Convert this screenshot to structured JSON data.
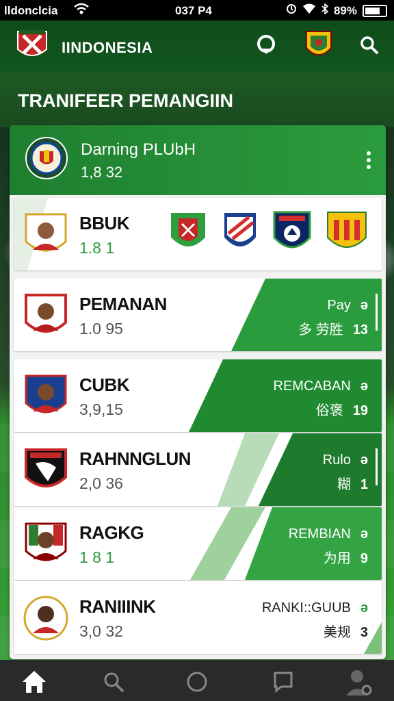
{
  "status_bar": {
    "carrier": "lldonclcia",
    "time": "037 P4",
    "battery": "89%"
  },
  "header": {
    "title": "IINDONESIA",
    "icons": [
      "club-logo-icon",
      "notification-icon",
      "club-crest-icon",
      "search-icon"
    ]
  },
  "section_title": "TRANIFEER PEMANGIIN",
  "club": {
    "name": "Darning PLUbH",
    "value": "1,8 32"
  },
  "rows": [
    {
      "name": "BBUK",
      "value": "1.8 1",
      "value_color": "#2b9c3d",
      "type": "clubs"
    },
    {
      "name": "PEMANAN",
      "value": "1.0 95",
      "meta_top": "Pay",
      "meta_bottom": "多 劳胜",
      "count": "13"
    },
    {
      "name": "CUBK",
      "value": "3,9,15",
      "meta_top": "REMCABAN",
      "meta_bottom": "俗褒",
      "count": "19"
    },
    {
      "name": "RAHNNGLUN",
      "value": "2,0 36",
      "meta_top": "Rulo",
      "meta_bottom": "糊",
      "count": "1"
    },
    {
      "name": "RAGKG",
      "value": "1 8 1",
      "meta_top": "REMBIAN",
      "meta_bottom": "为用",
      "count": "9"
    },
    {
      "name": "RANIIINK",
      "value": "3,0 32",
      "meta_top": "RANKI::GUUB",
      "meta_bottom": "美规",
      "count": "3"
    }
  ],
  "row_icon_glyph": "ə",
  "colors": {
    "primary_green": "#2b9c3d",
    "dark_green": "#1f7f30",
    "header_green": "#0f4d1a",
    "nav_bg": "#2a2a2a"
  },
  "bottom_nav": [
    "home-icon",
    "search-icon",
    "circle-icon",
    "chat-icon",
    "profile-settings-icon"
  ]
}
